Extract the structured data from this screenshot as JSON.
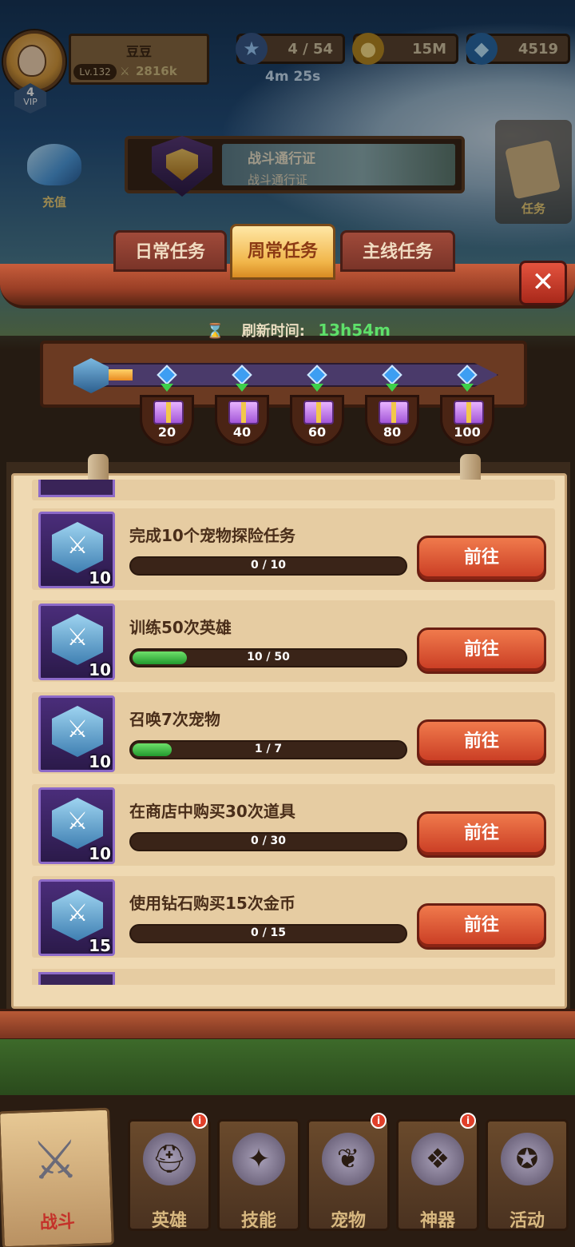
{
  "player": {
    "name": "豆豆",
    "level": "Lv.132",
    "power": "2816k",
    "vip_level": "4",
    "vip_label": "VIP"
  },
  "resources": {
    "stars": "4 / 54",
    "stars_timer": "4m 25s",
    "gold": "15M",
    "gems": "4519"
  },
  "side": {
    "recharge_label": "充值",
    "tasks_label": "任务"
  },
  "battle_pass": {
    "title": "战斗通行证",
    "subtitle": "战斗通行证"
  },
  "tabs": [
    {
      "label": "日常任务",
      "active": false
    },
    {
      "label": "周常任务",
      "active": true
    },
    {
      "label": "主线任务",
      "active": false
    }
  ],
  "close_symbol": "✕",
  "refresh": {
    "label": "刷新时间:",
    "time": "13h54m"
  },
  "milestones": [
    {
      "value": "20"
    },
    {
      "value": "40"
    },
    {
      "value": "60"
    },
    {
      "value": "80"
    },
    {
      "value": "100"
    }
  ],
  "milestone_progress": 0.08,
  "tasks": [
    {
      "title": "完成10个宠物探险任务",
      "progress_text": "0 / 10",
      "progress": 0.0,
      "reward": "10",
      "button": "前往"
    },
    {
      "title": "训练50次英雄",
      "progress_text": "10 / 50",
      "progress": 0.2,
      "reward": "10",
      "button": "前往"
    },
    {
      "title": "召唤7次宠物",
      "progress_text": "1 / 7",
      "progress": 0.1429,
      "reward": "10",
      "button": "前往"
    },
    {
      "title": "在商店中购买30次道具",
      "progress_text": "0 / 30",
      "progress": 0.0,
      "reward": "10",
      "button": "前往"
    },
    {
      "title": "使用钻石购买15次金币",
      "progress_text": "0 / 15",
      "progress": 0.0,
      "reward": "15",
      "button": "前往"
    }
  ],
  "nav": [
    {
      "label": "战斗",
      "icon": "crossed-swords-icon",
      "active": true
    },
    {
      "label": "英雄",
      "icon": "helmet-icon",
      "badge": "i"
    },
    {
      "label": "技能",
      "icon": "spellbook-icon"
    },
    {
      "label": "宠物",
      "icon": "wings-icon",
      "badge": "i"
    },
    {
      "label": "神器",
      "icon": "artifact-icon",
      "badge": "i"
    },
    {
      "label": "活动",
      "icon": "treasure-icon"
    }
  ],
  "colors": {
    "accent_green": "#5ee06a",
    "button_red": "#c83a22",
    "tab_active": "#f1b64a"
  }
}
